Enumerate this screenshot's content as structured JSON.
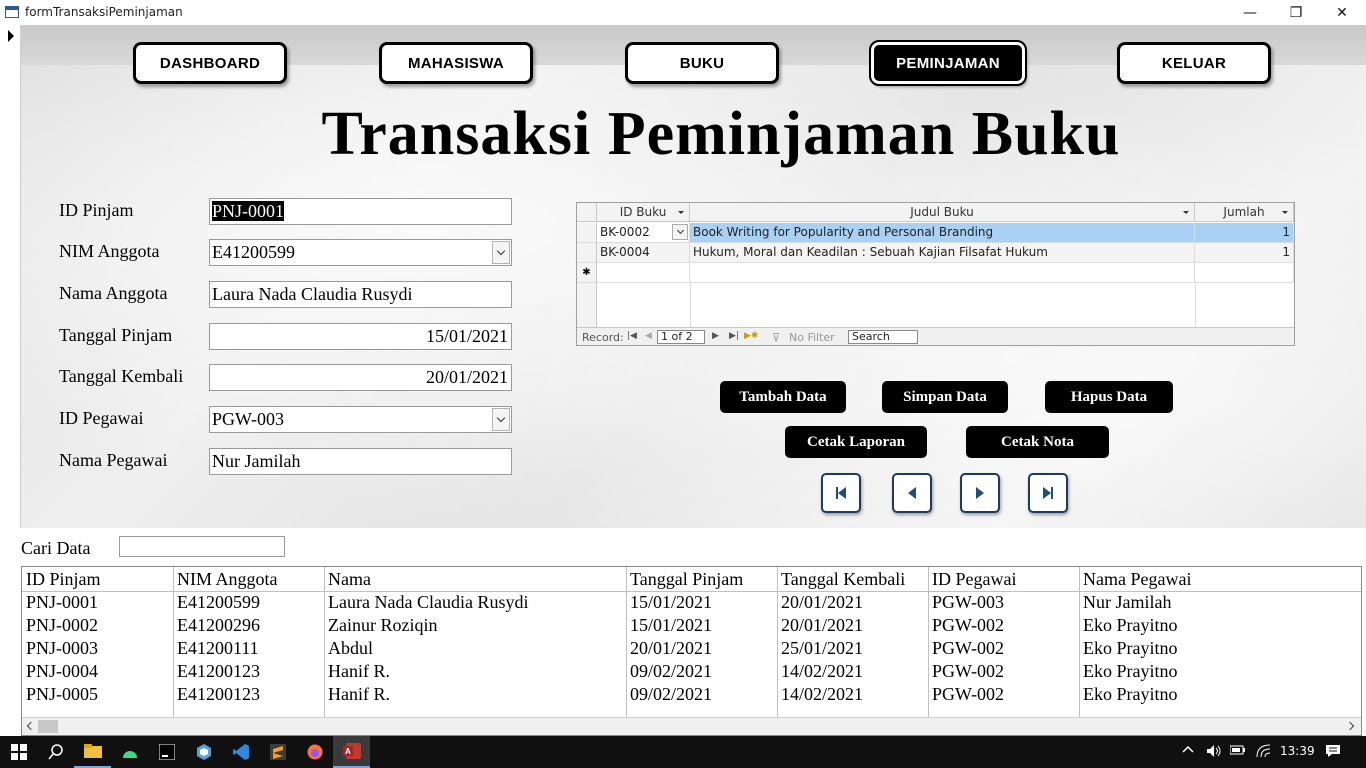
{
  "window": {
    "title": "formTransaksiPeminjaman",
    "minimize_glyph": "—",
    "restore_glyph": "❐",
    "close_glyph": "✕"
  },
  "nav": {
    "items": [
      {
        "label": "DASHBOARD",
        "active": false
      },
      {
        "label": "MAHASISWA",
        "active": false
      },
      {
        "label": "BUKU",
        "active": false
      },
      {
        "label": "PEMINJAMAN",
        "active": true
      },
      {
        "label": "KELUAR",
        "active": false
      }
    ]
  },
  "page_title": "Transaksi Peminjaman Buku",
  "form": {
    "id_pinjam": {
      "label": "ID Pinjam",
      "value": "PNJ-0001"
    },
    "nim_anggota": {
      "label": "NIM Anggota",
      "value": "E41200599"
    },
    "nama_anggota": {
      "label": "Nama Anggota",
      "value": "Laura Nada Claudia Rusydi"
    },
    "tanggal_pinjam": {
      "label": "Tanggal Pinjam",
      "value": "15/01/2021"
    },
    "tanggal_kembali": {
      "label": "Tanggal Kembali",
      "value": "20/01/2021"
    },
    "id_pegawai": {
      "label": "ID Pegawai",
      "value": "PGW-003"
    },
    "nama_pegawai": {
      "label": "Nama Pegawai",
      "value": "Nur Jamilah"
    }
  },
  "subform": {
    "columns": [
      "ID Buku",
      "Judul Buku",
      "Jumlah"
    ],
    "rows": [
      {
        "id_buku": "BK-0002",
        "judul": "Book Writing for Popularity and Personal Branding",
        "jumlah": "1"
      },
      {
        "id_buku": "BK-0004",
        "judul": "Hukum, Moral dan Keadilan : Sebuah Kajian Filsafat Hukum",
        "jumlah": "1"
      }
    ],
    "new_row_marker": "✱",
    "nav": {
      "record_label": "Record:",
      "position": "1 of 2",
      "filter_label": "No Filter",
      "search_placeholder": "Search"
    }
  },
  "actions": {
    "tambah": "Tambah Data",
    "simpan": "Simpan Data",
    "hapus": "Hapus Data",
    "cetak_laporan": "Cetak Laporan",
    "cetak_nota": "Cetak Nota"
  },
  "search": {
    "label": "Cari Data",
    "value": ""
  },
  "grid": {
    "columns": [
      "ID Pinjam",
      "NIM Anggota",
      "Nama",
      "Tanggal Pinjam",
      "Tanggal Kembali",
      "ID Pegawai",
      "Nama Pegawai"
    ],
    "rows": [
      [
        "PNJ-0001",
        "E41200599",
        "Laura Nada Claudia Rusydi",
        "15/01/2021",
        "20/01/2021",
        "PGW-003",
        "Nur Jamilah"
      ],
      [
        "PNJ-0002",
        "E41200296",
        "Zainur Roziqin",
        "15/01/2021",
        "20/01/2021",
        "PGW-002",
        "Eko Prayitno"
      ],
      [
        "PNJ-0003",
        "E41200111",
        "Abdul",
        "20/01/2021",
        "25/01/2021",
        "PGW-002",
        "Eko Prayitno"
      ],
      [
        "PNJ-0004",
        "E41200123",
        "Hanif R.",
        "09/02/2021",
        "14/02/2021",
        "PGW-002",
        "Eko Prayitno"
      ],
      [
        "PNJ-0005",
        "E41200123",
        "Hanif R.",
        "09/02/2021",
        "14/02/2021",
        "PGW-002",
        "Eko Prayitno"
      ]
    ]
  },
  "taskbar": {
    "clock": "13:39",
    "icons": [
      "windows-start-icon",
      "search-icon",
      "file-explorer-icon",
      "android-studio-icon",
      "intellij-icon",
      "app-hex-icon",
      "vscode-icon",
      "sublime-icon",
      "firefox-icon",
      "access-icon"
    ]
  },
  "colors": {
    "accent_selected_row": "#a9d1f3",
    "button_bg": "#000000",
    "nav_icon_blue": "#1f4e79"
  }
}
